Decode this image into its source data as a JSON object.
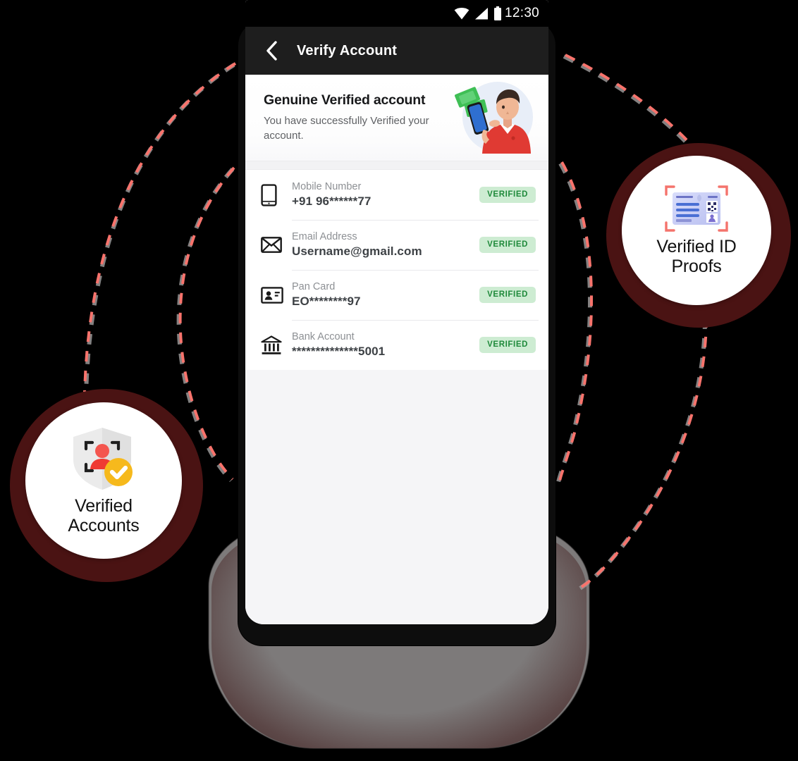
{
  "statusbar": {
    "time": "12:30",
    "icons": [
      "wifi-icon",
      "signal-icon",
      "battery-icon"
    ]
  },
  "appbar": {
    "back_icon": "chevron-left-icon",
    "title": "Verify Account"
  },
  "hero": {
    "title": "Genuine Verified account",
    "subtitle": "You have successfully Verified your account.",
    "illustration": "man-with-phone-and-money-illustration"
  },
  "list": {
    "rows": [
      {
        "icon": "smartphone-icon",
        "label": "Mobile Number",
        "value": "+91 96******77",
        "badge": "VERIFIED"
      },
      {
        "icon": "envelope-icon",
        "label": "Email Address",
        "value": "Username@gmail.com",
        "badge": "VERIFIED"
      },
      {
        "icon": "id-card-icon",
        "label": "Pan Card",
        "value": "EO********97",
        "badge": "VERIFIED"
      },
      {
        "icon": "bank-icon",
        "label": "Bank Account",
        "value": "**************5001",
        "badge": "VERIFIED"
      }
    ]
  },
  "callouts": [
    {
      "id": "verified-accounts",
      "line1": "Verified",
      "line2": "Accounts",
      "icon": "shield-face-scan-check-icon"
    },
    {
      "id": "verified-id-proofs",
      "line1": "Verified ID",
      "line2": "Proofs",
      "icon": "id-card-scan-icon"
    }
  ],
  "colors": {
    "page_background": "#000000",
    "appbar": "#1e1e1e",
    "badge_background": "#cdecd2",
    "badge_text": "#1f8a3b",
    "callout_ring": "#4a1313",
    "connector_dash": "#f9736c",
    "screen_background": "#f5f5f7"
  }
}
